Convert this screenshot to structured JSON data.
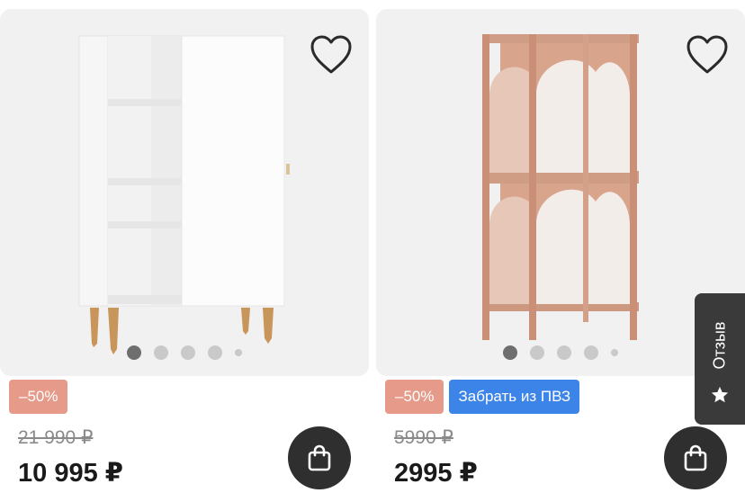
{
  "products": [
    {
      "image_alt": "white-shelf-cabinet",
      "discount_badge": "–50%",
      "old_price": "21 990 ₽",
      "price": "10 995 ₽",
      "gallery_dots": 5,
      "gallery_active": 1
    },
    {
      "image_alt": "pink-arch-rack",
      "discount_badge": "–50%",
      "pickup_badge": "Забрать из ПВЗ",
      "old_price": "5990 ₽",
      "price": "2995 ₽",
      "gallery_dots": 5,
      "gallery_active": 1
    }
  ],
  "feedback": {
    "label": "Отзыв"
  },
  "colors": {
    "discount": "#e59a8a",
    "pickup": "#3d84e8",
    "dark_button": "#2f2f2f",
    "card_bg": "#f1f1f1"
  },
  "icons": [
    "heart-icon",
    "shopping-bag-icon",
    "star-icon"
  ]
}
